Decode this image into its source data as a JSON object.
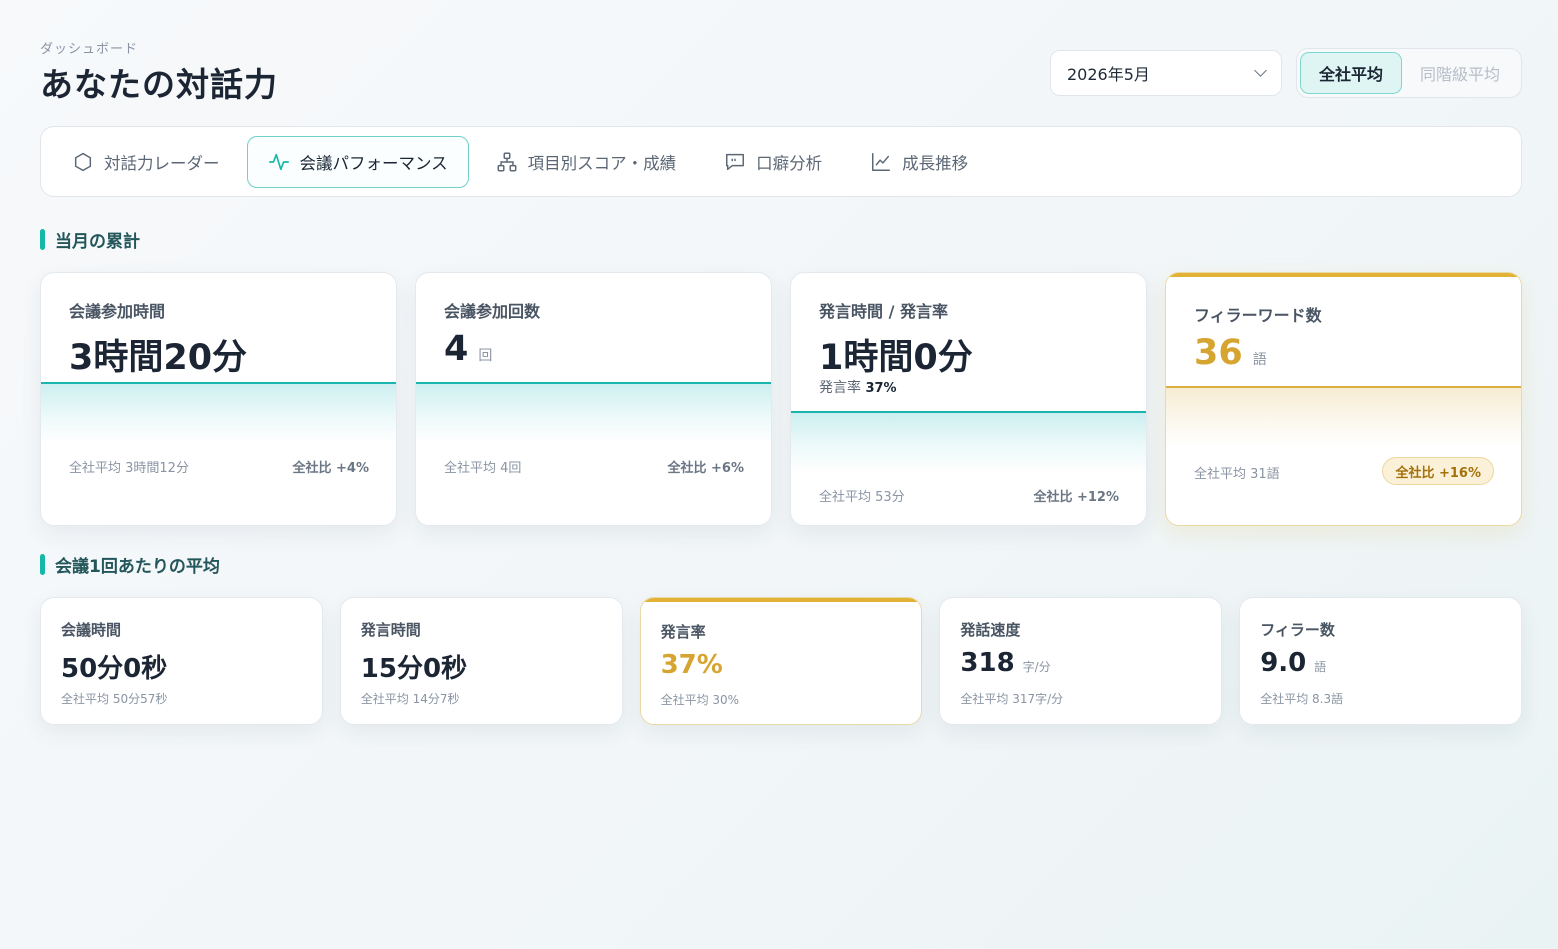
{
  "header": {
    "breadcrumb": "ダッシュボード",
    "title": "あなたの対話力",
    "month": "2026年5月",
    "compare": {
      "options": [
        "全社平均",
        "同階級平均"
      ],
      "selected": "全社平均"
    }
  },
  "tabs": [
    {
      "label": "対話力レーダー",
      "icon": "hexagon-icon",
      "active": false
    },
    {
      "label": "会議パフォーマンス",
      "icon": "activity-icon",
      "active": true
    },
    {
      "label": "項目別スコア・成績",
      "icon": "hierarchy-icon",
      "active": false
    },
    {
      "label": "口癖分析",
      "icon": "chat-quote-icon",
      "active": false
    },
    {
      "label": "成長推移",
      "icon": "line-chart-icon",
      "active": false
    }
  ],
  "monthly": {
    "section_title": "当月の累計",
    "cards": [
      {
        "label": "会議参加時間",
        "value": "3時間20分",
        "unit": "",
        "sub_label": "",
        "sub_value": "",
        "avg": "全社平均 3時間12分",
        "comparison": "全社比 +4%"
      },
      {
        "label": "会議参加回数",
        "value": "4",
        "unit": "回",
        "sub_label": "",
        "sub_value": "",
        "avg": "全社平均 4回",
        "comparison": "全社比 +6%"
      },
      {
        "label": "発言時間 / 発言率",
        "value": "1時間0分",
        "unit": "",
        "sub_label": "発言率",
        "sub_value": "37%",
        "avg": "全社平均 53分",
        "comparison": "全社比 +12%"
      },
      {
        "label": "フィラーワード数",
        "value": "36",
        "unit": "語",
        "sub_label": "",
        "sub_value": "",
        "avg": "全社平均 31語",
        "comparison": "全社比 +16%"
      }
    ]
  },
  "per_meeting": {
    "section_title": "会議1回あたりの平均",
    "cards": [
      {
        "label": "会議時間",
        "value": "50分0秒",
        "unit": "",
        "avg": "全社平均 50分57秒"
      },
      {
        "label": "発言時間",
        "value": "15分0秒",
        "unit": "",
        "avg": "全社平均 14分7秒"
      },
      {
        "label": "発言率",
        "value": "37%",
        "unit": "",
        "avg": "全社平均 30%"
      },
      {
        "label": "発話速度",
        "value": "318",
        "unit": "字/分",
        "avg": "全社平均 317字/分"
      },
      {
        "label": "フィラー数",
        "value": "9.0",
        "unit": "語",
        "avg": "全社平均 8.3語"
      }
    ]
  },
  "colors": {
    "accent": "#14b8a6",
    "highlight": "#d6a531"
  }
}
